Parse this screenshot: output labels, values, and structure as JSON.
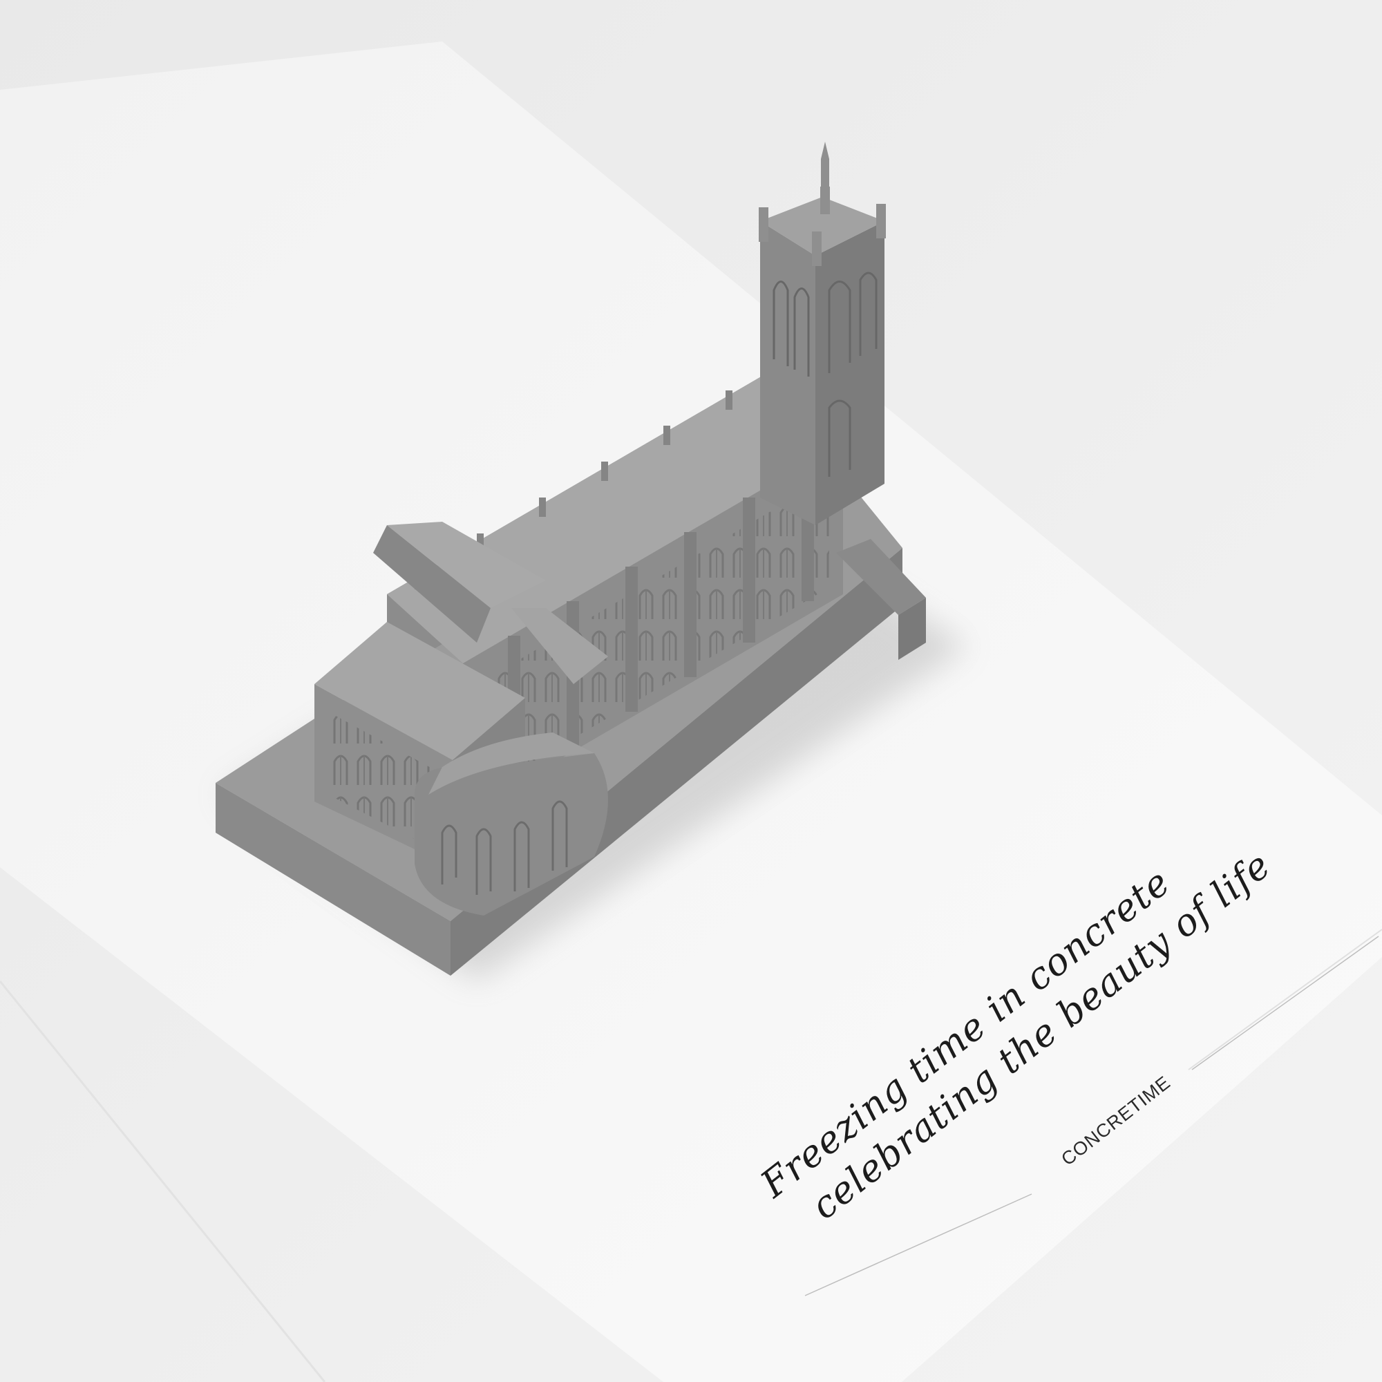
{
  "card": {
    "tagline_line1": "Freezing time in concrete",
    "tagline_line2": "celebrating the beauty of life",
    "brand": "CONCRETIME"
  },
  "colors": {
    "background": "#efefef",
    "card": "#f7f7f7",
    "concrete_light": "#a3a3a3",
    "concrete_mid": "#8f8f8f",
    "concrete_dark": "#7a7a7a",
    "text": "#1c1c1c"
  }
}
